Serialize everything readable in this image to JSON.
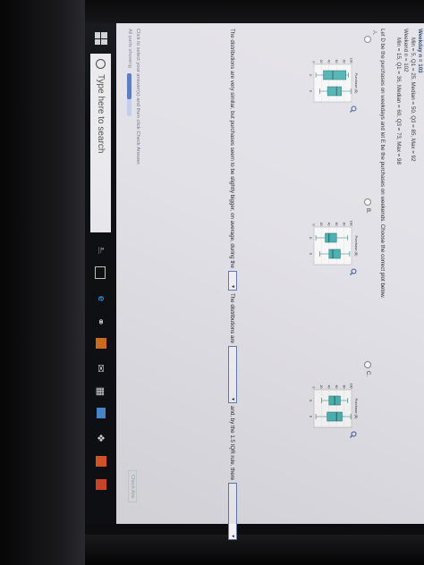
{
  "header": {
    "partial_title": "Weekday n = 103",
    "weekday_stats": "Min = 5, Q1 = 25, Median = 50, Q3 = 85, Max = 92",
    "weekend_n": "Weekend n = 102",
    "weekend_stats": "Min = 15, Q1 = 36, Median = 60, Q3 = 73, Max = 98"
  },
  "question": "Let D be the purchases on weekdays and let E be the purchases on weekends. Choose the correct plot below.",
  "hint": "A.",
  "options": [
    {
      "id": "A",
      "label": "",
      "plot_title": "Purchase ($)",
      "cat_d": "D",
      "cat_e": "E",
      "ticks": [
        "100",
        "80",
        "60",
        "40",
        "20",
        "0"
      ],
      "d": [
        5,
        25,
        50,
        85,
        92
      ],
      "e": [
        15,
        36,
        60,
        73,
        98
      ]
    },
    {
      "id": "B",
      "label": "B.",
      "plot_title": "Purchase ($)",
      "cat_d": "D",
      "cat_e": "E",
      "ticks": [
        "100",
        "80",
        "60",
        "40",
        "20",
        "0"
      ],
      "d": [
        5,
        30,
        40,
        60,
        90
      ],
      "e": [
        15,
        40,
        50,
        70,
        95
      ]
    },
    {
      "id": "C",
      "label": "C.",
      "plot_title": "Purchase ($)",
      "cat_d": "D",
      "cat_e": "E",
      "ticks": [
        "100",
        "80",
        "60",
        "40",
        "20",
        "0"
      ],
      "d": [
        20,
        40,
        55,
        70,
        90
      ],
      "e": [
        5,
        35,
        60,
        75,
        98
      ]
    }
  ],
  "sentence": {
    "part1": "The distributions are very similar, but purchases seem to be slightly bigger, on average, during the",
    "part2": "The distributions are",
    "part3": "and, by the 1.5 IQR rule, there",
    "dd_symbol": "▼"
  },
  "footer": {
    "instructions": "Click to select your answer(s) and then click Check Answer.",
    "parts_label": "All parts showing",
    "progress": 0.6,
    "next_label": "Check Ans"
  },
  "taskbar": {
    "search_placeholder": "Type here to search"
  },
  "colors": {
    "box_fill": "#4fb7b7",
    "box_stroke": "#2f7d80",
    "accent": "#3557a8"
  }
}
